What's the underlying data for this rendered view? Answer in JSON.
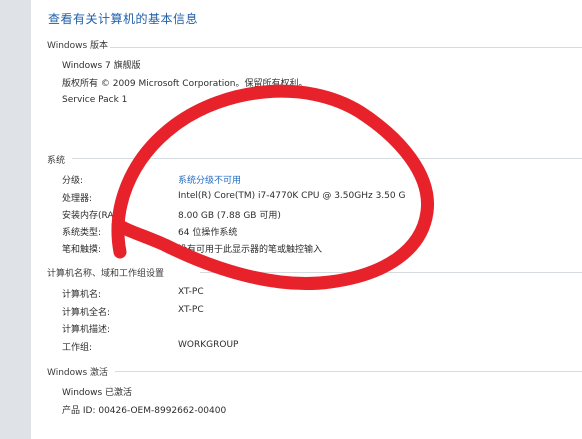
{
  "title": "查看有关计算机的基本信息",
  "windows_edition": {
    "heading": "Windows 版本",
    "lines": [
      "Windows 7 旗舰版",
      "版权所有 © 2009 Microsoft Corporation。保留所有权利。",
      "Service Pack 1"
    ]
  },
  "system": {
    "heading": "系统",
    "rows": [
      {
        "label": "分级:",
        "value": "系统分级不可用"
      },
      {
        "label": "处理器:",
        "value": "Intel(R) Core(TM) i7-4770K CPU @ 3.50GHz   3.50 G"
      },
      {
        "label": "安装内存(RA",
        "value": "8.00 GB (7.88 GB 可用)"
      },
      {
        "label": "系统类型:",
        "value": "64 位操作系统"
      },
      {
        "label": "笔和触摸:",
        "value": "没有可用于此显示器的笔或触控输入"
      }
    ]
  },
  "computer_name": {
    "heading": "计算机名称、域和工作组设置",
    "rows": [
      {
        "label": "计算机名:",
        "value": "XT-PC"
      },
      {
        "label": "计算机全名:",
        "value": "XT-PC"
      },
      {
        "label": "计算机描述:",
        "value": ""
      },
      {
        "label": "工作组:",
        "value": "WORKGROUP"
      }
    ]
  },
  "activation": {
    "heading": "Windows 激活",
    "status": "Windows 已激活",
    "product_id": "产品 ID: 00426-OEM-8992662-00400"
  },
  "colors": {
    "title": "#1e5fa8",
    "link": "#1f6bc4",
    "scribble": "#e8222a"
  }
}
